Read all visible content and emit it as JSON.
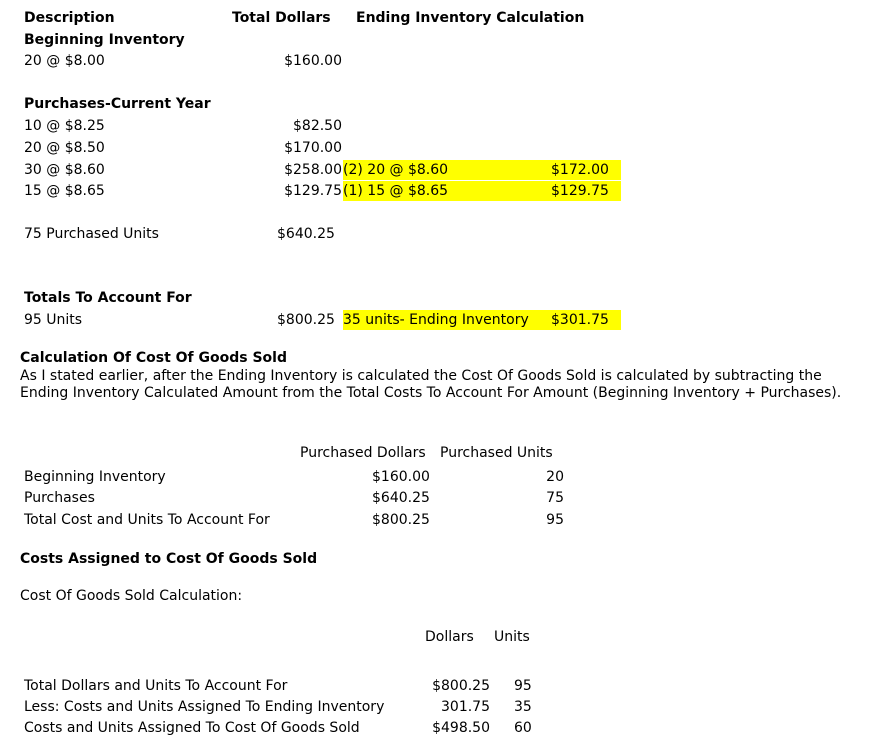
{
  "inventory": {
    "headers": {
      "description": "Description",
      "total": "Total Dollars",
      "ending": "Ending Inventory Calculation"
    },
    "beginning_heading": "Beginning Inventory",
    "beginning_row": {
      "desc": "20 @ $8.00",
      "total": "$160.00"
    },
    "purchases_heading": "Purchases-Current Year",
    "purchases": [
      {
        "desc": "10 @ $8.25",
        "total": "$82.50"
      },
      {
        "desc": "20 @ $8.50",
        "total": "$170.00"
      },
      {
        "desc": "30 @ $8.60",
        "total": "$258.00",
        "calc": "(2) 20 @ $8.60",
        "calc_amount": "$172.00"
      },
      {
        "desc": "15 @ $8.65",
        "total": "$129.75",
        "calc": "(1) 15 @ $8.65",
        "calc_amount": "$129.75"
      }
    ],
    "purchased_units": {
      "desc": "75 Purchased Units",
      "total": "$640.25"
    },
    "totals_heading": "Totals To Account For",
    "totals_row": {
      "desc": "95 Units",
      "total": "$800.25",
      "calc": "35 units- Ending Inventory",
      "calc_amount": "$301.75"
    },
    "highlight_color": "#ffff00"
  },
  "cogs": {
    "heading": "Calculation Of Cost Of Goods Sold",
    "paragraph": "As I stated earlier, after the Ending Inventory is calculated the Cost Of Goods Sold is calculated by subtracting the Ending Inventory Calculated Amount from the Total Costs To Account For Amount (Beginning Inventory + Purchases).",
    "table_headers": {
      "dollars": "Purchased Dollars",
      "units": "Purchased Units"
    },
    "table_rows": [
      {
        "label": "Beginning Inventory",
        "dollars": "$160.00",
        "units": "20"
      },
      {
        "label": "Purchases",
        "dollars": "$640.25",
        "units": "75"
      },
      {
        "label": "Total Cost and Units To Account For",
        "dollars": "$800.25",
        "units": "95"
      }
    ]
  },
  "assigned": {
    "heading": "Costs Assigned to Cost Of Goods Sold",
    "subheading": "Cost Of Goods Sold Calculation:",
    "table_headers": {
      "dollars": "Dollars",
      "units": "Units"
    },
    "rows": [
      {
        "label": "Total Dollars and Units To Account For",
        "dollars": "$800.25",
        "units": "95"
      },
      {
        "label": "Less: Costs and Units Assigned To Ending Inventory",
        "dollars": "301.75",
        "units": "35"
      },
      {
        "label": "Costs and Units Assigned To Cost Of Goods Sold",
        "dollars": "$498.50",
        "units": "60"
      }
    ]
  }
}
